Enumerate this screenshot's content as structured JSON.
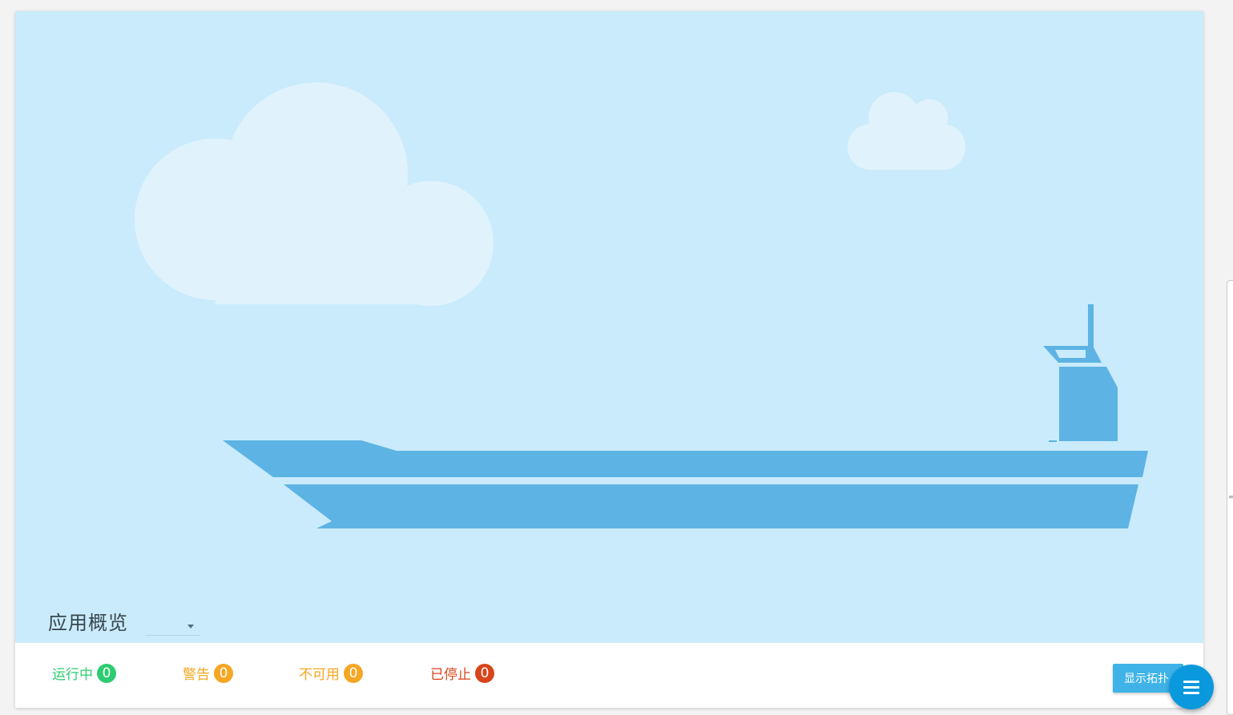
{
  "overview": {
    "title": "应用概览",
    "selected_value": ""
  },
  "status": {
    "running": {
      "label": "运行中",
      "count": "0",
      "color": "#2ecc71"
    },
    "warning": {
      "label": "警告",
      "count": "0",
      "color": "#f5a623"
    },
    "unavailable": {
      "label": "不可用",
      "count": "0",
      "color": "#f5a623"
    },
    "stopped": {
      "label": "已停止",
      "count": "0",
      "color": "#d9441b"
    }
  },
  "actions": {
    "show_topology_label": "显示拓扑",
    "fab_icon": "menu-icon"
  },
  "colors": {
    "sky": "#caebfb",
    "cloud": "#e0f3fd",
    "ship": "#5db4e4",
    "accent": "#0b99dd"
  }
}
